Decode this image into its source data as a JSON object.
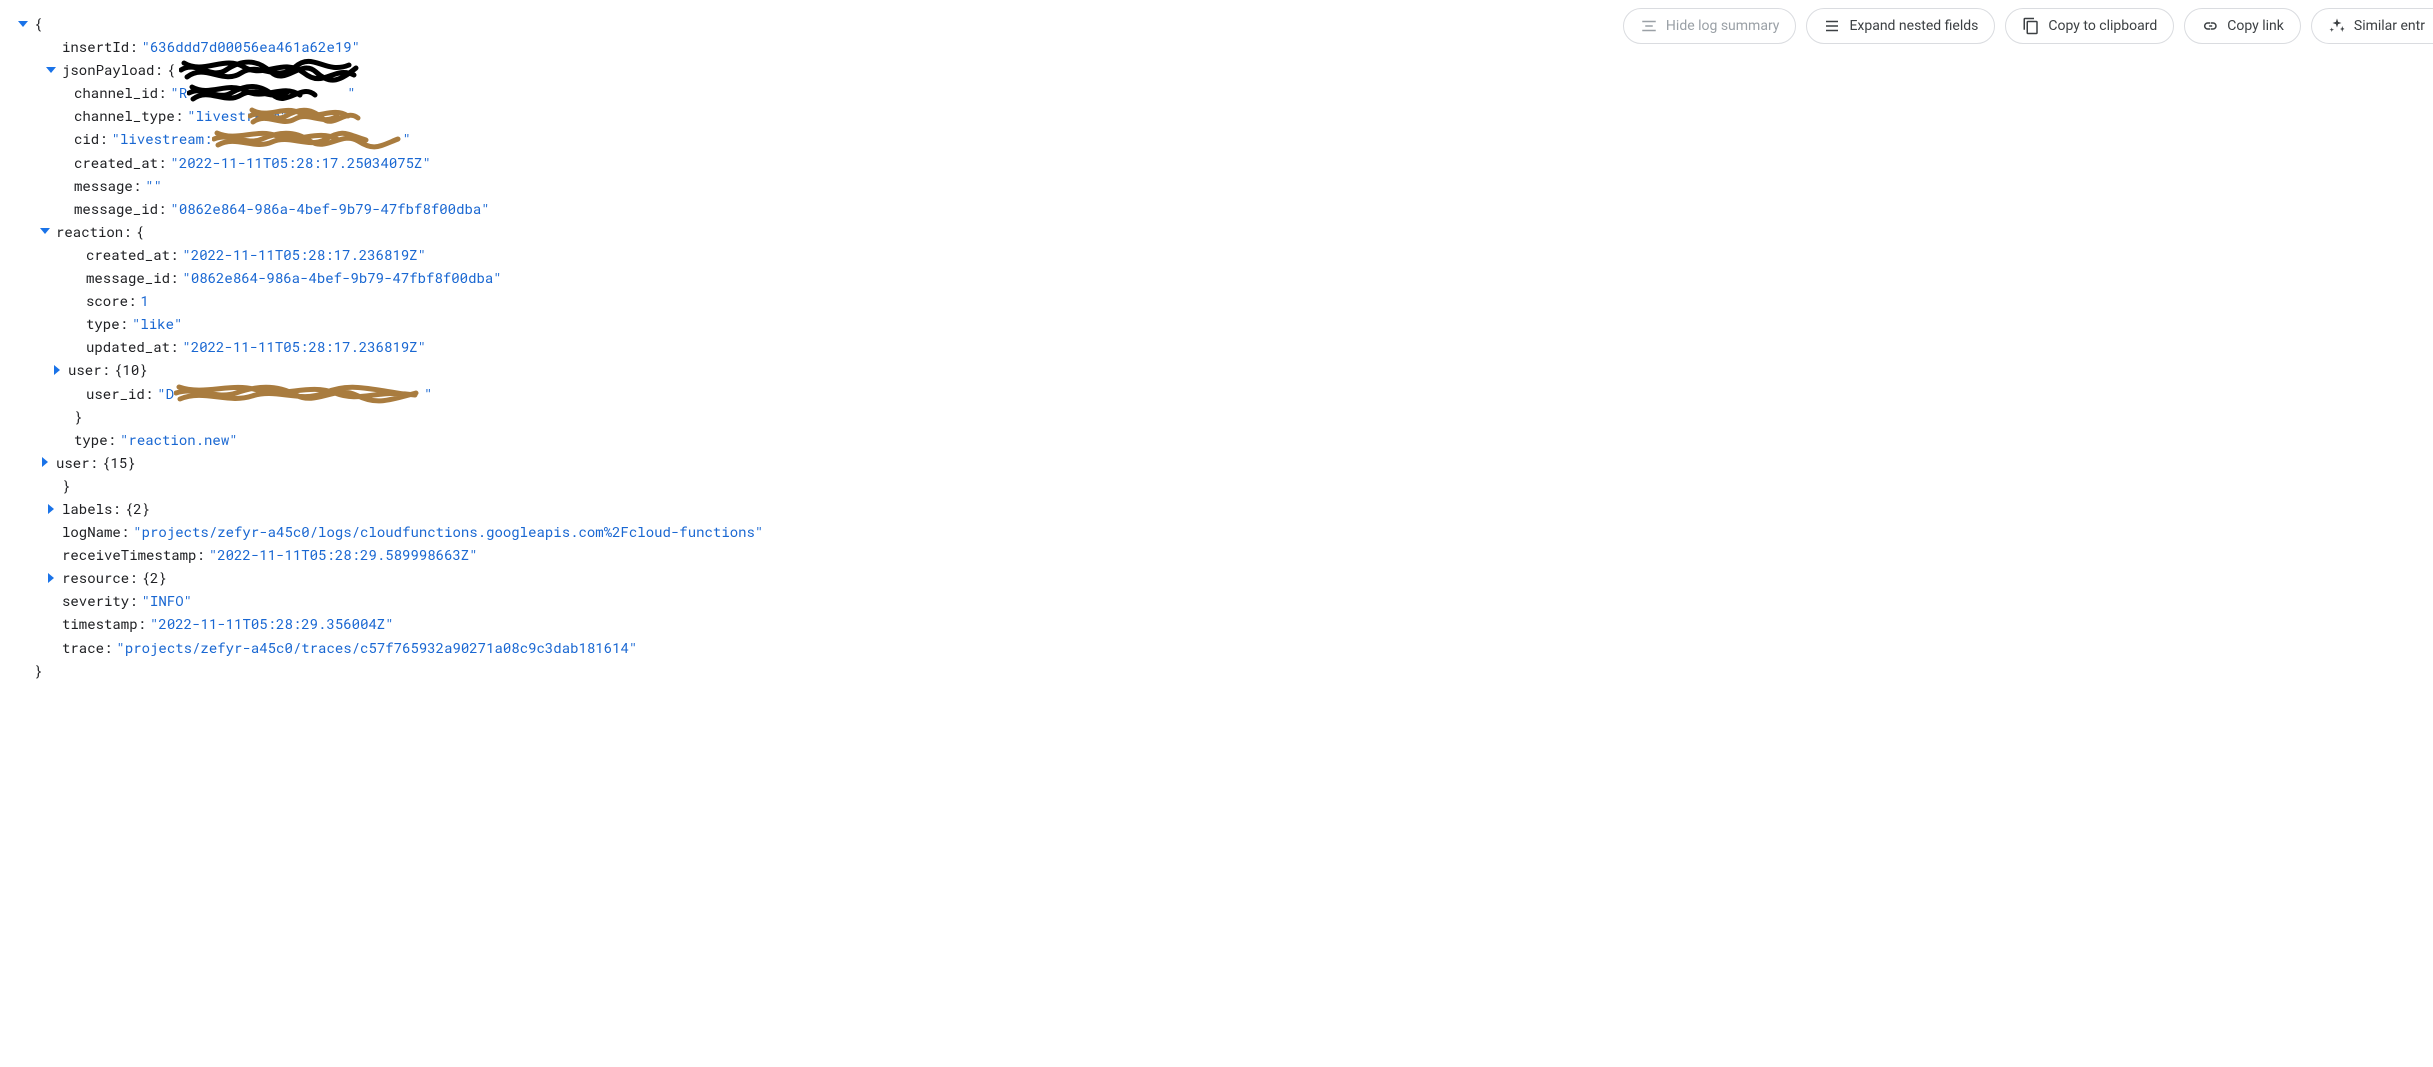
{
  "toolbar": {
    "hide_log_summary": "Hide log summary",
    "expand_nested": "Expand nested fields",
    "copy_clipboard": "Copy to clipboard",
    "copy_link": "Copy link",
    "similar_entries": "Similar entr"
  },
  "log": {
    "insertId": {
      "key": "insertId",
      "value": "\"636ddd7d00056ea461a62e19\""
    },
    "jsonPayload": {
      "key": "jsonPayload",
      "open": "{",
      "channel_id": {
        "key": "channel_id",
        "value_prefix": "\"R",
        "value_suffix": "\""
      },
      "channel_type": {
        "key": "channel_type",
        "value": "\"livestream\""
      },
      "cid": {
        "key": "cid",
        "value_prefix": "\"livestream:",
        "value_suffix": "\""
      },
      "created_at": {
        "key": "created_at",
        "value": "\"2022-11-11T05:28:17.25034075Z\""
      },
      "message": {
        "key": "message",
        "value": "\"\""
      },
      "message_id": {
        "key": "message_id",
        "value": "\"0862e864-986a-4bef-9b79-47fbf8f00dba\""
      },
      "reaction": {
        "key": "reaction",
        "open": "{",
        "created_at": {
          "key": "created_at",
          "value": "\"2022-11-11T05:28:17.236819Z\""
        },
        "message_id": {
          "key": "message_id",
          "value": "\"0862e864-986a-4bef-9b79-47fbf8f00dba\""
        },
        "score": {
          "key": "score",
          "value": "1"
        },
        "type": {
          "key": "type",
          "value": "\"like\""
        },
        "updated_at": {
          "key": "updated_at",
          "value": "\"2022-11-11T05:28:17.236819Z\""
        },
        "user": {
          "key": "user",
          "summary": "{10}"
        },
        "user_id": {
          "key": "user_id",
          "value_prefix": "\"D",
          "value_suffix": "\""
        },
        "close": "}"
      },
      "type": {
        "key": "type",
        "value": "\"reaction.new\""
      },
      "user": {
        "key": "user",
        "summary": "{15}"
      },
      "close": "}"
    },
    "labels": {
      "key": "labels",
      "summary": "{2}"
    },
    "logName": {
      "key": "logName",
      "value": "\"projects/zefyr-a45c0/logs/cloudfunctions.googleapis.com%2Fcloud-functions\""
    },
    "receiveTimestamp": {
      "key": "receiveTimestamp",
      "value": "\"2022-11-11T05:28:29.589998663Z\""
    },
    "resource": {
      "key": "resource",
      "summary": "{2}"
    },
    "severity": {
      "key": "severity",
      "value": "\"INFO\""
    },
    "timestamp": {
      "key": "timestamp",
      "value": "\"2022-11-11T05:28:29.356004Z\""
    },
    "trace": {
      "key": "trace",
      "value": "\"projects/zefyr-a45c0/traces/c57f765932a90271a08c9c3dab181614\""
    },
    "close": "}"
  }
}
